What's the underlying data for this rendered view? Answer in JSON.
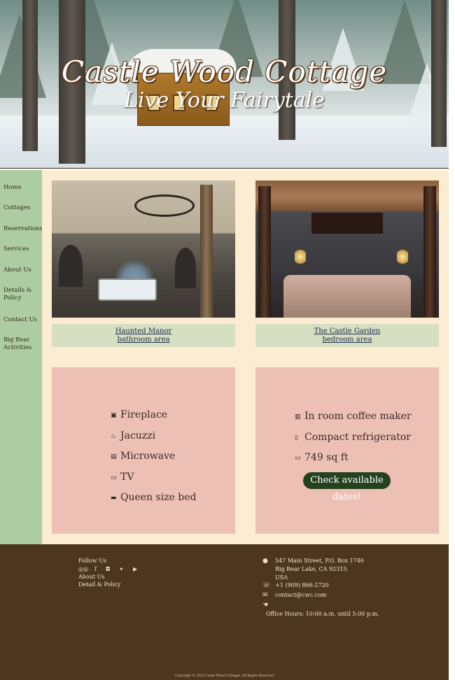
{
  "hero": {
    "title": "Castle Wood Cottage",
    "subtitle": "Live Your Fairytale"
  },
  "sidebar": {
    "items": [
      {
        "label": "Home"
      },
      {
        "label": "Cottages"
      },
      {
        "label": "Reservations"
      },
      {
        "label": "Services"
      },
      {
        "label": "About Us"
      },
      {
        "label": "Details & Policy"
      },
      {
        "label": "Contact Us"
      },
      {
        "label": "Big Bear Activities"
      }
    ]
  },
  "gallery": [
    {
      "caption_line1": "Haunted Manor",
      "caption_line2": "bathroom area"
    },
    {
      "caption_line1": "The Castle Garden",
      "caption_line2": "bedroom area"
    }
  ],
  "amenities_left": [
    {
      "icon": "fireplace-icon",
      "label": "Fireplace"
    },
    {
      "icon": "jacuzzi-icon",
      "label": "Jacuzzi"
    },
    {
      "icon": "microwave-icon",
      "label": "Microwave"
    },
    {
      "icon": "tv-icon",
      "label": "TV"
    },
    {
      "icon": "bed-icon",
      "label": "Queen size bed"
    }
  ],
  "amenities_right": [
    {
      "icon": "coffee-maker-icon",
      "label": "In room coffee maker"
    },
    {
      "icon": "refrigerator-icon",
      "label": "Compact refrigerator"
    },
    {
      "icon": "ruler-icon",
      "label": "749 sq ft"
    }
  ],
  "cta": {
    "label": "Check available dates!"
  },
  "footer": {
    "follow_us": "Follow Us",
    "about_us": "About Us",
    "detail_policy": "Detail & Policy",
    "social": [
      "tripadvisor-icon",
      "facebook-icon",
      "instagram-icon",
      "twitter-icon",
      "youtube-icon"
    ],
    "address_line1": "547 Main Street, P.O. Box 1746",
    "address_line2": "Big Bear Lake, CA 92315.",
    "address_line3": "USA",
    "phone": "+1 (909) 866-2720",
    "email": "contact@cwc.com",
    "office_hours": "Office Hours: 10:00 a.m. until 5:00 p.m.",
    "copyright": "Copyright © 2023 Castle Wood Cottages. All Rights Reserved"
  },
  "colors": {
    "sidebar": "#aecca1",
    "main_bg": "#fcecd2",
    "caption_bg": "#d6dfc1",
    "amenity_bg": "#edc0b6",
    "button": "#24421e",
    "footer": "#4d3620"
  }
}
